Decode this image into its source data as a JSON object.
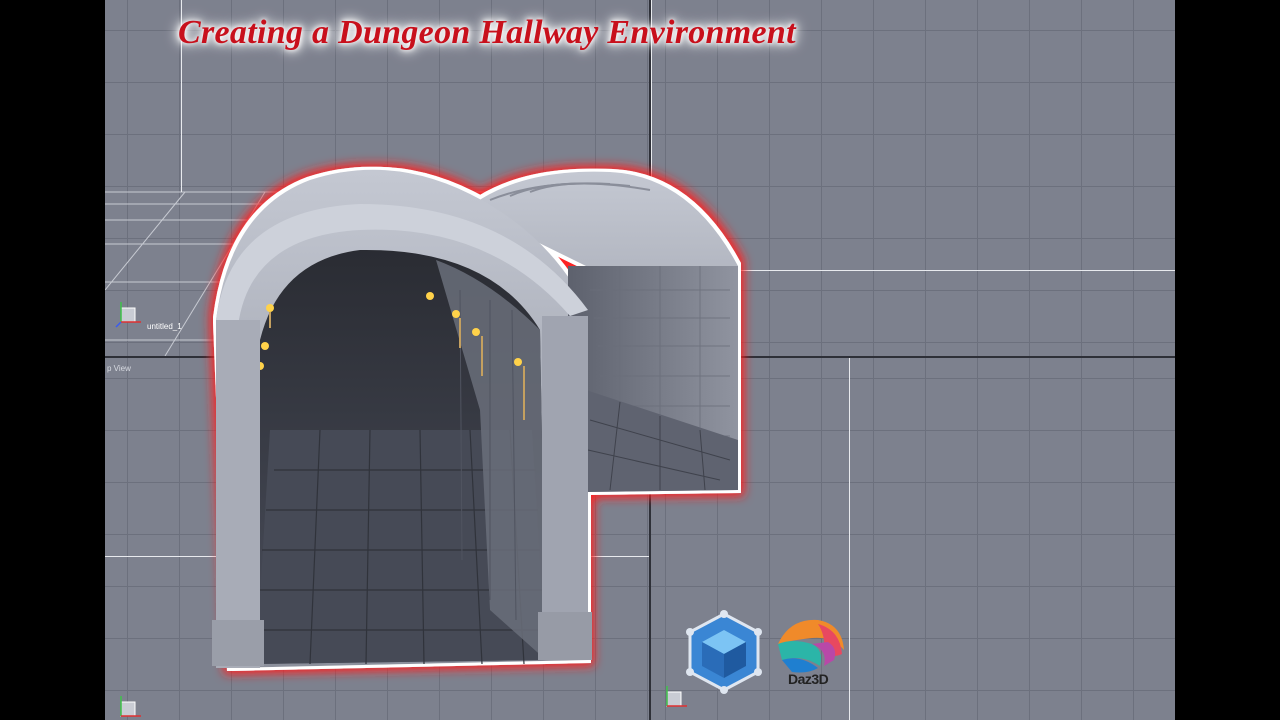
{
  "title": "Creating a Dungeon Hallway Environment",
  "viewports": {
    "perspective_label": "untitled_1",
    "top_label": "p View"
  },
  "logos": {
    "daz_text": "Daz3D",
    "cube_icon": "hexagon-cube-icon",
    "daz_icon": "daz3d-logo-icon"
  },
  "colors": {
    "title": "#c8101c",
    "glow": "#ff2a2a",
    "grid": "#7d818e",
    "stone": "#a6aab6"
  }
}
